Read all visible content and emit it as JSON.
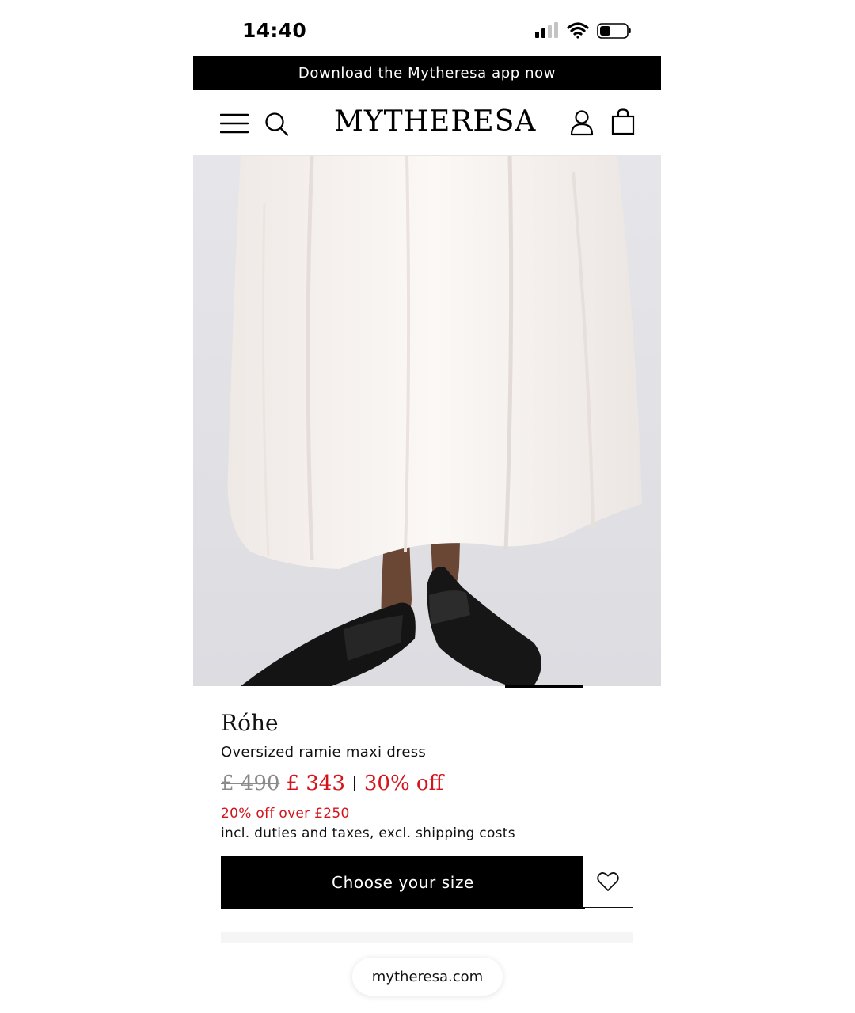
{
  "status_bar": {
    "time": "14:40",
    "battery_level": 0.35
  },
  "promo_banner": {
    "text": "Download the Mytheresa app now"
  },
  "header": {
    "logo": "MYTHERESA",
    "icons": [
      "menu-icon",
      "search-icon",
      "account-icon",
      "shopping-bag-icon"
    ]
  },
  "product": {
    "image_alt": "white maxi dress with black loafers",
    "brand": "Róhe",
    "name": "Oversized ramie maxi dress",
    "old_price": "£ 490",
    "new_price": "£ 343",
    "discount": "30% off",
    "promo": "20% off over £250",
    "tax_note": "incl. duties and taxes, excl. shipping costs"
  },
  "actions": {
    "choose_size": "Choose your size",
    "wishlist_icon": "heart-icon"
  },
  "browser": {
    "url": "mytheresa.com"
  },
  "colors": {
    "black": "#000000",
    "sale_red": "#d4141b",
    "old_price_grey": "#8a8a8a"
  }
}
